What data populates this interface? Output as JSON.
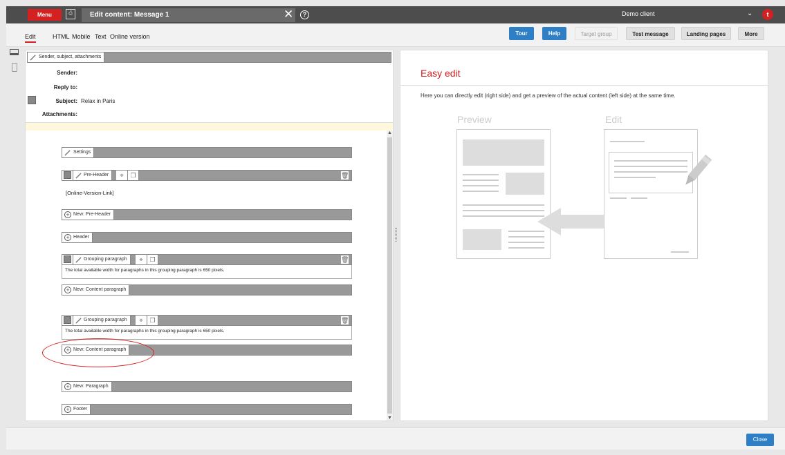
{
  "topbar": {
    "menu_label": "Menu",
    "doc_tab_title": "Edit content: Message 1",
    "close_symbol": "✕",
    "help_symbol": "?",
    "client_name": "Demo client",
    "chevron": "⌄",
    "user_initial": "t"
  },
  "view_tabs": [
    {
      "label": "Edit",
      "active": true
    },
    {
      "label": "HTML"
    },
    {
      "label": "Mobile"
    },
    {
      "label": "Text"
    },
    {
      "label": "Online version"
    }
  ],
  "toolbar_buttons": {
    "tour": "Tour",
    "help": "Help",
    "target_group": "Target group",
    "test_message": "Test message",
    "landing_pages": "Landing pages",
    "more": "More"
  },
  "header_section": {
    "bar_label": "Sender, subject, attachments",
    "sender_label": "Sender:",
    "reply_label": "Reply to:",
    "subject_label": "Subject:",
    "subject_value": "Relax in Paris",
    "attachments_label": "Attachments:"
  },
  "blocks": {
    "settings": "Settings",
    "preheader": "Pre-Header",
    "online_link": "[Online-Version-Link]",
    "new_preheader": "New: Pre-Header",
    "header": "Header",
    "grouping1": "Grouping paragraph",
    "grouping1_note": "The total available width for paragraphs in this grouping paragraph is 650 pixels.",
    "new_content1": "New: Content paragraph",
    "grouping2": "Grouping paragraph",
    "grouping2_note": "The total available width for paragraphs in this grouping paragraph is 650 pixels.",
    "new_content2": "New: Content paragraph",
    "new_paragraph": "New: Paragraph",
    "footer": "Footer"
  },
  "easy_edit": {
    "title": "Easy edit",
    "description": "Here you can directly edit (right side) and get a preview of the actual content (left side) at the same time.",
    "preview_label": "Preview",
    "edit_label": "Edit"
  },
  "bottom": {
    "close_label": "Close"
  },
  "colors": {
    "accent_red": "#d32020",
    "button_blue": "#2f7fc6",
    "topbar": "#4d4d4d"
  }
}
